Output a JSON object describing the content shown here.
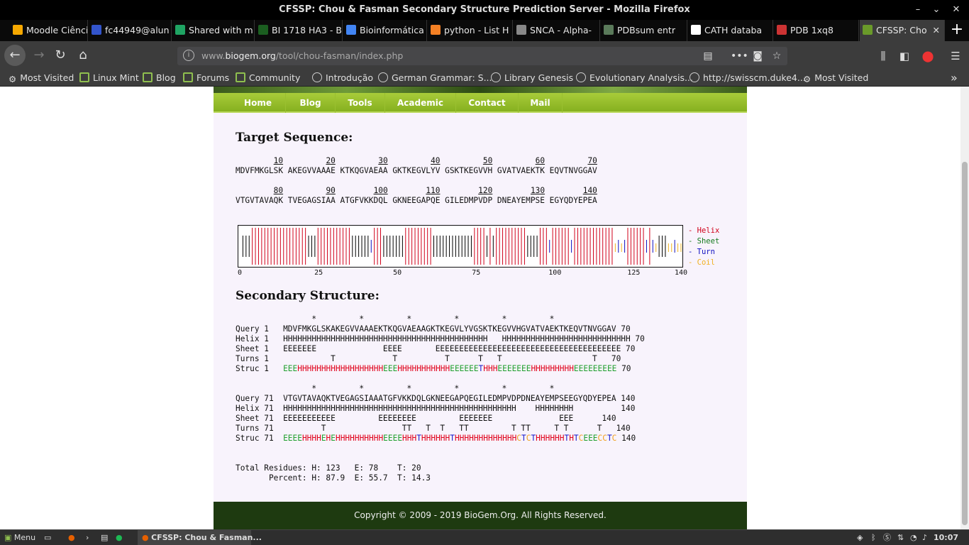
{
  "window": {
    "title": "CFSSP: Chou & Fasman Secondary Structure Prediction Server - Mozilla Firefox"
  },
  "tabs": [
    {
      "label": "Moodle Ciênci",
      "color": "#f6a800"
    },
    {
      "label": "fc44949@alun",
      "color": "#3355cc"
    },
    {
      "label": "Shared with m",
      "color": "#1fa463"
    },
    {
      "label": "BI 1718 HA3 - BI_",
      "color": "#1b5e20"
    },
    {
      "label": "Bioinformática",
      "color": "#4285f4"
    },
    {
      "label": "python - List H",
      "color": "#f48024"
    },
    {
      "label": "SNCA - Alpha-",
      "color": "#888888"
    },
    {
      "label": "PDBsum entr",
      "color": "#5a7a5a"
    },
    {
      "label": "CATH databa",
      "color": "#ffffff"
    },
    {
      "label": "PDB 1xq8",
      "color": "#cc3333"
    },
    {
      "label": "CFSSP: Cho",
      "color": "#6a9a2a"
    }
  ],
  "address": {
    "prefix": "www.",
    "domain": "biogem.org",
    "path": "/tool/chou-fasman/index.php"
  },
  "bookmarks": [
    {
      "label": "Most Visited",
      "icon": "gear-icon"
    },
    {
      "label": "Linux Mint",
      "icon": "mint-icon"
    },
    {
      "label": "Blog",
      "icon": "mint-icon"
    },
    {
      "label": "Forums",
      "icon": "mint-icon"
    },
    {
      "label": "Community",
      "icon": "mint-icon"
    },
    {
      "label": "Introdução",
      "icon": "globe-icon"
    },
    {
      "label": "German Grammar: S...",
      "icon": "globe-icon"
    },
    {
      "label": "Library Genesis",
      "icon": "globe-icon"
    },
    {
      "label": "Evolutionary Analysis...",
      "icon": "globe-icon"
    },
    {
      "label": "http://swisscm.duke4...",
      "icon": "globe-icon"
    },
    {
      "label": "Most Visited",
      "icon": "gear-icon"
    }
  ],
  "menu": [
    "Home",
    "Blog",
    "Tools",
    "Academic",
    "Contact",
    "Mail"
  ],
  "target_heading": "Target Sequence:",
  "sequence": {
    "ruler1": [
      "10",
      "20",
      "30",
      "40",
      "50",
      "60",
      "70"
    ],
    "line1": "MDVFMKGLSK AKEGVVAAAE KTKQGVAEAA GKTKEGVLYV GSKTKEGVVH GVATVAEKTK EQVTNVGGAV",
    "ruler2": [
      "80",
      "90",
      "100",
      "110",
      "120",
      "130",
      "140"
    ],
    "line2": "VTGVTAVAQK TVEGAGSIAA ATGFVKKDQL GKNEEGAPQE GILEDMPVDP DNEAYEMPSE EGYQDYEPEA"
  },
  "chart_data": {
    "type": "bar",
    "xlim": [
      0,
      140
    ],
    "xticks": [
      "0",
      "25",
      "50",
      "75",
      "100",
      "125",
      "140"
    ],
    "legend": [
      {
        "label": "Helix",
        "color": "#d0001a"
      },
      {
        "label": "Sheet",
        "color": "#157a1e"
      },
      {
        "label": "Turn",
        "color": "#1010c0"
      },
      {
        "label": "Coil",
        "color": "#f0b020"
      }
    ],
    "struc": "EEEHHHHHHHHHHHHHHHHHHEEEHHHHHHHHHHHEEEEEETHHHEEEEEEEHHHHHHHHHEEEEEEEEEEEEEHHHHEHEHHHHHHHHHHEEEEHHHTHHHHHHTHHHHHHHHHHHHHCTCTHHHHHHTHTCEEECCTCC"
  },
  "secondary_heading": "Secondary Structure:",
  "block1": {
    "stars": "                *         *         *         *         *         *",
    "query": "Query 1   MDVFMKGLSKAKEGVVAAAEKTKQGVAEAAGKTKEGVLYVGSKTKEGVVHGVATVAEKTKEQVTNVGGAV 70",
    "helix": "Helix 1   HHHHHHHHHHHHHHHHHHHHHHHHHHHHHHHHHHHHHHHHHHH   HHHHHHHHHHHHHHHHHHHHHHHHHHH 70",
    "sheet": "Sheet 1   EEEEEEE              EEEE       EEEEEEEEEEEEEEEEEEEEEEEEEEEEEEEEEEEEEEE 70",
    "turns": "Turns 1             T            T          T      T   T                   T   70",
    "struc_label": "Struc 1   ",
    "struc_end": " 70"
  },
  "block2": {
    "stars": "                *         *         *         *         *         *",
    "query": "Query 71  VTGVTAVAQKTVEGAGSIAAATGFVKKDQLGKNEEGAPQEGILEDMPVDPDNEAYEMPSEEGYQDYEPEA 140",
    "helix": "Helix 71  HHHHHHHHHHHHHHHHHHHHHHHHHHHHHHHHHHHHHHHHHHHHHHHHH    HHHHHHHH          140",
    "sheet": "Sheet 71  EEEEEEEEEEE         EEEEEEEE         EEEEEEE              EEE      140",
    "turns": "Turns 71          T                TT   T  T   TT         T TT     T T      T   140",
    "struc_label": "Struc 71  ",
    "struc_end": " 140"
  },
  "totals": {
    "line1": "Total Residues: H: 123   E: 78    T: 20",
    "line2": "       Percent: H: 87.9  E: 55.7  T: 14.3"
  },
  "footer": "Copyright © 2009 - 2019 BioGem.Org. All Rights Reserved.",
  "taskbar": {
    "menu": "Menu",
    "window": "CFSSP: Chou & Fasman...",
    "clock": "10:07"
  }
}
